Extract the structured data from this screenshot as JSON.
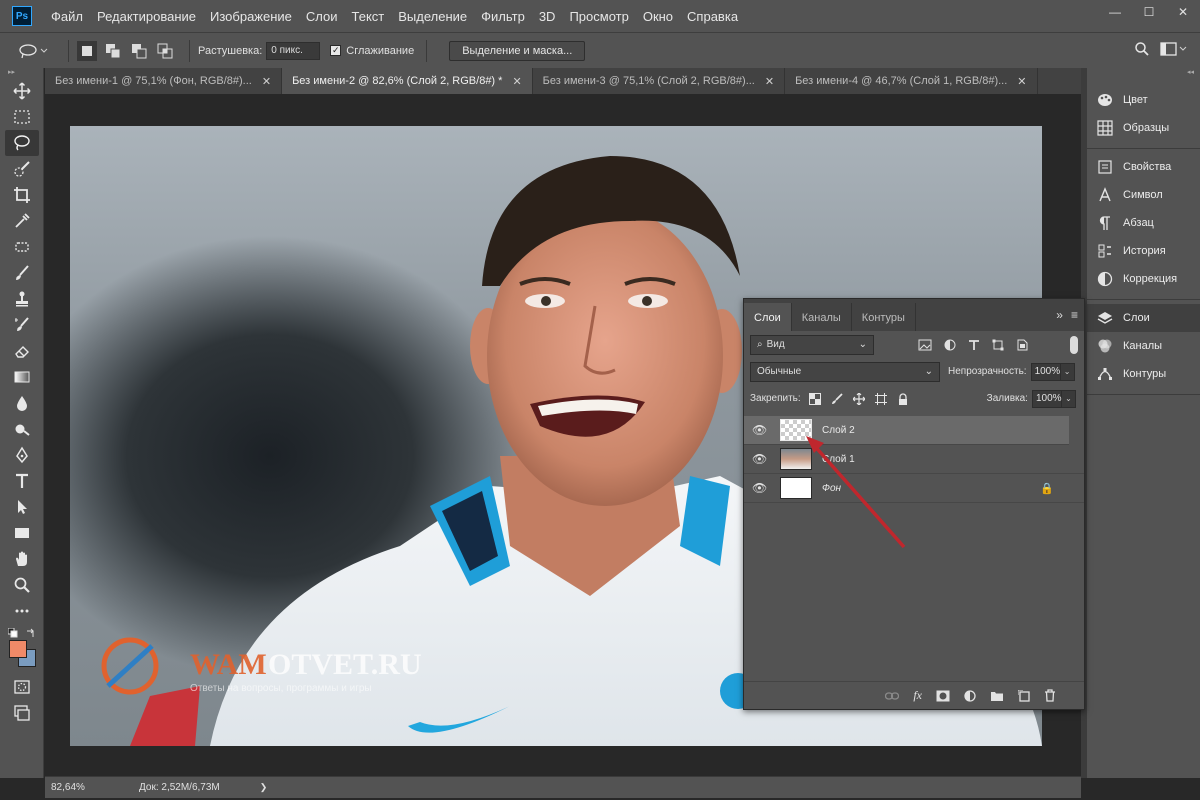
{
  "app": {
    "logo": "Ps",
    "menu": [
      "Файл",
      "Редактирование",
      "Изображение",
      "Слои",
      "Текст",
      "Выделение",
      "Фильтр",
      "3D",
      "Просмотр",
      "Окно",
      "Справка"
    ],
    "window_controls": {
      "minimize": "—",
      "maximize": "☐",
      "close": "✕"
    }
  },
  "options_bar": {
    "feather_label": "Растушевка:",
    "feather_value": "0 пикс.",
    "antialias_label": "Сглаживание",
    "antialias_checked": true,
    "select_mask_button": "Выделение и маска..."
  },
  "tabs": [
    {
      "label": "Без имени-1 @ 75,1% (Фон, RGB/8#)...",
      "active": false
    },
    {
      "label": "Без имени-2 @ 82,6% (Слой 2, RGB/8#) *",
      "active": true
    },
    {
      "label": "Без имени-3 @ 75,1% (Слой 2, RGB/8#)...",
      "active": false
    },
    {
      "label": "Без имени-4 @ 46,7% (Слой 1, RGB/8#)...",
      "active": false
    }
  ],
  "tab_close": "✕",
  "status": {
    "zoom": "82,64%",
    "doc": "Док: 2,52M/6,73M",
    "chevron": "❯"
  },
  "dock": {
    "groups": [
      [
        {
          "label": "Цвет",
          "icon": "palette-icon"
        },
        {
          "label": "Образцы",
          "icon": "swatches-icon"
        }
      ],
      [
        {
          "label": "Свойства",
          "icon": "properties-icon"
        },
        {
          "label": "Символ",
          "icon": "character-icon"
        },
        {
          "label": "Абзац",
          "icon": "paragraph-icon"
        },
        {
          "label": "История",
          "icon": "history-icon"
        },
        {
          "label": "Коррекция",
          "icon": "adjustments-icon"
        }
      ],
      [
        {
          "label": "Слои",
          "icon": "layers-icon",
          "active": true
        },
        {
          "label": "Каналы",
          "icon": "channels-icon"
        },
        {
          "label": "Контуры",
          "icon": "paths-icon"
        }
      ]
    ]
  },
  "layers_panel": {
    "tabs": [
      "Слои",
      "Каналы",
      "Контуры"
    ],
    "filter_label": "Вид",
    "blend_mode": "Обычные",
    "opacity_label": "Непрозрачность:",
    "opacity_value": "100%",
    "lock_label": "Закрепить:",
    "fill_label": "Заливка:",
    "fill_value": "100%",
    "layers": [
      {
        "name": "Слой 2",
        "selected": true,
        "thumb": "checker"
      },
      {
        "name": "Слой 1",
        "selected": false,
        "thumb": "photo"
      },
      {
        "name": "Фон",
        "selected": false,
        "thumb": "white",
        "locked": true
      }
    ],
    "bottom_icons": [
      "link-icon",
      "fx-icon",
      "mask-icon",
      "adjustment-layer-icon",
      "folder-icon",
      "new-layer-icon",
      "trash-icon"
    ]
  },
  "watermark": {
    "brand_part1": "WAM",
    "brand_part2": "OTVET.RU",
    "tagline": "Ответы на вопросы, программы и игры"
  },
  "colors": {
    "foreground": "#f08a68",
    "background": "#7a9cc0",
    "arrow": "#c0272d",
    "accent": "#31a8ff"
  }
}
